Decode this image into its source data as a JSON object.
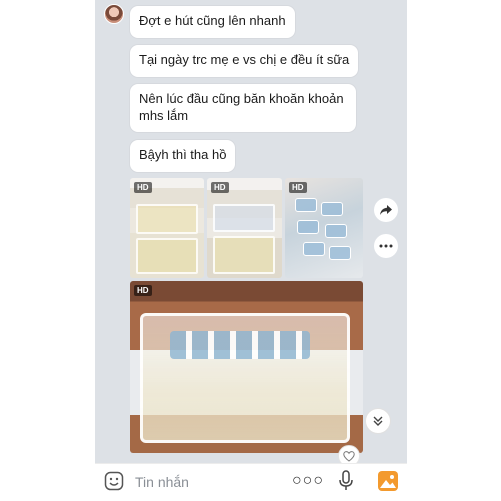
{
  "messages": [
    {
      "text": "Đợt e hút cũng lên nhanh"
    },
    {
      "text": "Tại ngày trc mẹ e vs chị e đều ít sữa"
    },
    {
      "text": "Nên lúc đầu cũng băn khoăn khoản mhs lắm"
    },
    {
      "text": "Bậyh thì tha hồ"
    }
  ],
  "photos": [
    {
      "badge": "HD"
    },
    {
      "badge": "HD"
    },
    {
      "badge": "HD"
    },
    {
      "badge": "HD"
    }
  ],
  "input": {
    "placeholder": "Tin nhắn",
    "more_label": "○○○"
  },
  "icons": {
    "share": "share-arrow-icon",
    "more": "more-dots-icon",
    "scroll": "double-chevron-down-icon",
    "heart": "heart-icon",
    "emoji": "emoji-icon",
    "mic": "microphone-icon",
    "gallery": "gallery-icon"
  },
  "colors": {
    "chat_background": "#dde1e6",
    "bubble": "#ffffff",
    "gallery_accent": "#f39a2e"
  }
}
